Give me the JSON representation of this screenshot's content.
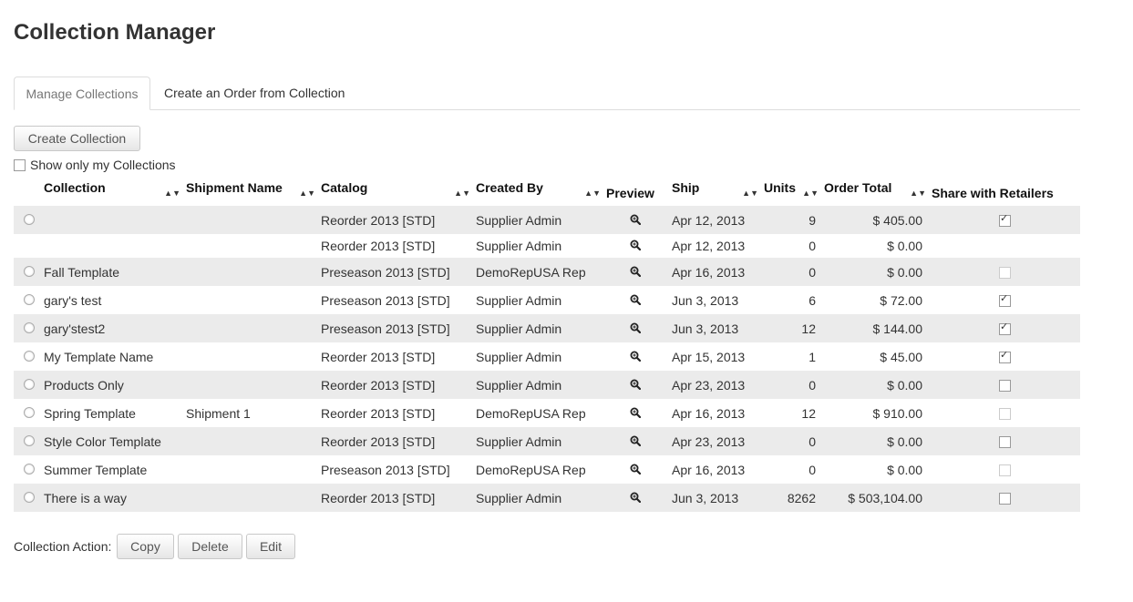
{
  "page": {
    "title": "Collection Manager"
  },
  "tabs": [
    {
      "label": "Manage Collections"
    },
    {
      "label": "Create an Order from Collection"
    }
  ],
  "toolbar": {
    "create_label": "Create Collection",
    "show_mine_label": "Show only my Collections"
  },
  "table": {
    "headers": [
      "Collection",
      "Shipment Name",
      "Catalog",
      "Created By",
      "Preview",
      "Ship",
      "Units",
      "Order Total",
      "Share with Retailers"
    ],
    "rows": [
      {
        "radio": true,
        "collection": "",
        "shipment": "",
        "catalog": "Reorder 2013 [STD]",
        "created_by": "Supplier Admin",
        "ship": "Apr 12, 2013",
        "units": "9",
        "total": "$ 405.00",
        "share": "checked"
      },
      {
        "radio": false,
        "collection": "",
        "shipment": "",
        "catalog": "Reorder 2013 [STD]",
        "created_by": "Supplier Admin",
        "ship": "Apr 12, 2013",
        "units": "0",
        "total": "$ 0.00",
        "share": "none"
      },
      {
        "radio": true,
        "collection": "Fall Template",
        "shipment": "",
        "catalog": "Preseason 2013 [STD]",
        "created_by": "DemoRepUSA Rep",
        "ship": "Apr 16, 2013",
        "units": "0",
        "total": "$ 0.00",
        "share": "disabled"
      },
      {
        "radio": true,
        "collection": "gary's test",
        "shipment": "",
        "catalog": "Preseason 2013 [STD]",
        "created_by": "Supplier Admin",
        "ship": "Jun 3, 2013",
        "units": "6",
        "total": "$ 72.00",
        "share": "checked"
      },
      {
        "radio": true,
        "collection": "gary'stest2",
        "shipment": "",
        "catalog": "Preseason 2013 [STD]",
        "created_by": "Supplier Admin",
        "ship": "Jun 3, 2013",
        "units": "12",
        "total": "$ 144.00",
        "share": "checked"
      },
      {
        "radio": true,
        "collection": "My Template Name",
        "shipment": "",
        "catalog": "Reorder 2013 [STD]",
        "created_by": "Supplier Admin",
        "ship": "Apr 15, 2013",
        "units": "1",
        "total": "$ 45.00",
        "share": "checked"
      },
      {
        "radio": true,
        "collection": "Products Only",
        "shipment": "",
        "catalog": "Reorder 2013 [STD]",
        "created_by": "Supplier Admin",
        "ship": "Apr 23, 2013",
        "units": "0",
        "total": "$ 0.00",
        "share": "unchecked"
      },
      {
        "radio": true,
        "collection": "Spring Template",
        "shipment": "Shipment 1",
        "catalog": "Reorder 2013 [STD]",
        "created_by": "DemoRepUSA Rep",
        "ship": "Apr 16, 2013",
        "units": "12",
        "total": "$ 910.00",
        "share": "disabled"
      },
      {
        "radio": true,
        "collection": "Style Color Template",
        "shipment": "",
        "catalog": "Reorder 2013 [STD]",
        "created_by": "Supplier Admin",
        "ship": "Apr 23, 2013",
        "units": "0",
        "total": "$ 0.00",
        "share": "unchecked"
      },
      {
        "radio": true,
        "collection": "Summer Template",
        "shipment": "",
        "catalog": "Preseason 2013 [STD]",
        "created_by": "DemoRepUSA Rep",
        "ship": "Apr 16, 2013",
        "units": "0",
        "total": "$ 0.00",
        "share": "disabled"
      },
      {
        "radio": true,
        "collection": "There is a way",
        "shipment": "",
        "catalog": "Reorder 2013 [STD]",
        "created_by": "Supplier Admin",
        "ship": "Jun 3, 2013",
        "units": "8262",
        "total": "$ 503,104.00",
        "share": "unchecked"
      }
    ]
  },
  "actions": {
    "label": "Collection Action:",
    "copy": "Copy",
    "delete": "Delete",
    "edit": "Edit"
  },
  "icons": {
    "sort": "sort-arrows-icon",
    "preview": "magnifier-zoom-icon",
    "row_select": "radio-icon"
  }
}
